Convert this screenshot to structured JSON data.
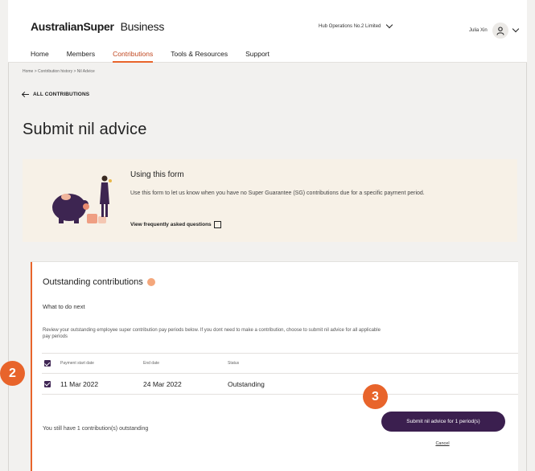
{
  "header": {
    "brand": "AustralianSuper",
    "brand_suffix": "Business",
    "organisation": "Hub Operations No.2 Limited",
    "user_name": "Julia Xin"
  },
  "nav": {
    "items": [
      {
        "label": "Home"
      },
      {
        "label": "Members"
      },
      {
        "label": "Contributions",
        "active": true
      },
      {
        "label": "Tools & Resources"
      },
      {
        "label": "Support"
      }
    ]
  },
  "breadcrumb": "Home >  Contribution history > Nil Advice",
  "back_link": "ALL CONTRIBUTIONS",
  "page_title": "Submit nil advice",
  "info": {
    "title": "Using this form",
    "text": "Use this form to let us know when you have no Super Guarantee (SG) contributions due for a specific payment period.",
    "faq_link": "View frequently asked questions"
  },
  "card": {
    "title": "Outstanding contributions",
    "next_heading": "What to do next",
    "review_text": "Review your outstanding employee super contribution pay periods below. If you dont need to make a contribution, choose to submit nil advice for all applicable pay periods",
    "columns": [
      "Payment start date",
      "End date",
      "Status"
    ],
    "rows": [
      {
        "start": "11 Mar 2022",
        "end": "24 Mar 2022",
        "status": "Outstanding",
        "checked": true
      }
    ],
    "remaining_text": "You still have 1 contribution(s) outstanding",
    "submit_label": "Submit nil advice for 1 period(s)",
    "cancel_label": "Cancel"
  },
  "markers": [
    "2",
    "3"
  ],
  "colors": {
    "accent": "#e8642b",
    "primary_button": "#3b1f4f",
    "info_bg": "#f7f1e7",
    "page_bg": "#f2f1ef"
  }
}
